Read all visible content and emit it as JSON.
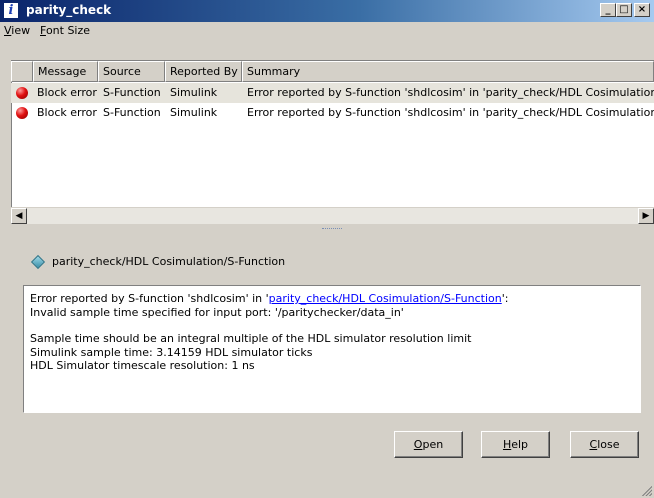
{
  "window": {
    "title": "parity_check",
    "icon": "info-icon",
    "controls": {
      "minimize": "_",
      "maximize": "□",
      "close": "×"
    }
  },
  "menu": [
    {
      "label": "View",
      "accel": "V",
      "rest": "iew"
    },
    {
      "label": "Font Size",
      "accel": "F",
      "rest": "ont Size"
    }
  ],
  "table": {
    "columns": [
      "Message",
      "Source",
      "Reported By",
      "Summary"
    ],
    "rows": [
      {
        "icon": "error-icon",
        "message": "Block error",
        "source": "S-Function",
        "reported_by": "Simulink",
        "summary": "Error reported by S-function 'shdlcosim' in 'parity_check/HDL Cosimulation/S-Fu"
      },
      {
        "icon": "error-icon",
        "message": "Block error",
        "source": "S-Function",
        "reported_by": "Simulink",
        "summary": "Error reported by S-function 'shdlcosim' in 'parity_check/HDL Cosimulation/S-Fu"
      }
    ]
  },
  "detail": {
    "path": "parity_check/HDL Cosimulation/S-Function",
    "line1_prefix": "Error reported by S-function 'shdlcosim' in '",
    "line1_link": "parity_check/HDL Cosimulation/S-Function",
    "line1_suffix": "':",
    "line2": "Invalid sample time specified for input port: '/paritychecker/data_in'",
    "line3": "Sample time should be an integral multiple of the HDL simulator resolution limit",
    "line4": "Simulink sample time: 3.14159 HDL simulator ticks",
    "line5": "HDL Simulator timescale resolution: 1 ns"
  },
  "buttons": {
    "open": {
      "accel": "O",
      "rest": "pen"
    },
    "help": {
      "accel": "H",
      "rest": "elp"
    },
    "close": {
      "accel": "C",
      "rest": "lose"
    }
  }
}
